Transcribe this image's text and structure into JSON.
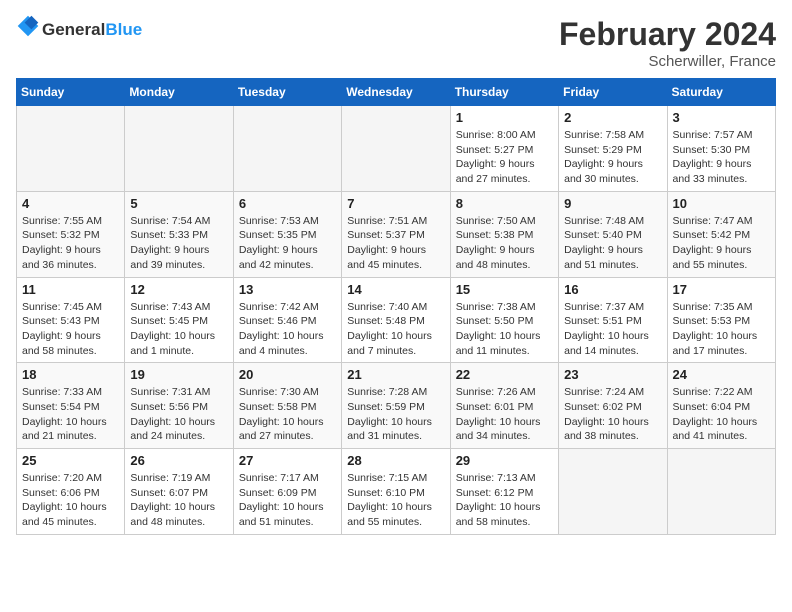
{
  "logo": {
    "line1": "General",
    "line2": "Blue"
  },
  "title": "February 2024",
  "location": "Scherwiller, France",
  "days_header": [
    "Sunday",
    "Monday",
    "Tuesday",
    "Wednesday",
    "Thursday",
    "Friday",
    "Saturday"
  ],
  "weeks": [
    [
      {
        "day": "",
        "info": ""
      },
      {
        "day": "",
        "info": ""
      },
      {
        "day": "",
        "info": ""
      },
      {
        "day": "",
        "info": ""
      },
      {
        "day": "1",
        "info": "Sunrise: 8:00 AM\nSunset: 5:27 PM\nDaylight: 9 hours\nand 27 minutes."
      },
      {
        "day": "2",
        "info": "Sunrise: 7:58 AM\nSunset: 5:29 PM\nDaylight: 9 hours\nand 30 minutes."
      },
      {
        "day": "3",
        "info": "Sunrise: 7:57 AM\nSunset: 5:30 PM\nDaylight: 9 hours\nand 33 minutes."
      }
    ],
    [
      {
        "day": "4",
        "info": "Sunrise: 7:55 AM\nSunset: 5:32 PM\nDaylight: 9 hours\nand 36 minutes."
      },
      {
        "day": "5",
        "info": "Sunrise: 7:54 AM\nSunset: 5:33 PM\nDaylight: 9 hours\nand 39 minutes."
      },
      {
        "day": "6",
        "info": "Sunrise: 7:53 AM\nSunset: 5:35 PM\nDaylight: 9 hours\nand 42 minutes."
      },
      {
        "day": "7",
        "info": "Sunrise: 7:51 AM\nSunset: 5:37 PM\nDaylight: 9 hours\nand 45 minutes."
      },
      {
        "day": "8",
        "info": "Sunrise: 7:50 AM\nSunset: 5:38 PM\nDaylight: 9 hours\nand 48 minutes."
      },
      {
        "day": "9",
        "info": "Sunrise: 7:48 AM\nSunset: 5:40 PM\nDaylight: 9 hours\nand 51 minutes."
      },
      {
        "day": "10",
        "info": "Sunrise: 7:47 AM\nSunset: 5:42 PM\nDaylight: 9 hours\nand 55 minutes."
      }
    ],
    [
      {
        "day": "11",
        "info": "Sunrise: 7:45 AM\nSunset: 5:43 PM\nDaylight: 9 hours\nand 58 minutes."
      },
      {
        "day": "12",
        "info": "Sunrise: 7:43 AM\nSunset: 5:45 PM\nDaylight: 10 hours\nand 1 minute."
      },
      {
        "day": "13",
        "info": "Sunrise: 7:42 AM\nSunset: 5:46 PM\nDaylight: 10 hours\nand 4 minutes."
      },
      {
        "day": "14",
        "info": "Sunrise: 7:40 AM\nSunset: 5:48 PM\nDaylight: 10 hours\nand 7 minutes."
      },
      {
        "day": "15",
        "info": "Sunrise: 7:38 AM\nSunset: 5:50 PM\nDaylight: 10 hours\nand 11 minutes."
      },
      {
        "day": "16",
        "info": "Sunrise: 7:37 AM\nSunset: 5:51 PM\nDaylight: 10 hours\nand 14 minutes."
      },
      {
        "day": "17",
        "info": "Sunrise: 7:35 AM\nSunset: 5:53 PM\nDaylight: 10 hours\nand 17 minutes."
      }
    ],
    [
      {
        "day": "18",
        "info": "Sunrise: 7:33 AM\nSunset: 5:54 PM\nDaylight: 10 hours\nand 21 minutes."
      },
      {
        "day": "19",
        "info": "Sunrise: 7:31 AM\nSunset: 5:56 PM\nDaylight: 10 hours\nand 24 minutes."
      },
      {
        "day": "20",
        "info": "Sunrise: 7:30 AM\nSunset: 5:58 PM\nDaylight: 10 hours\nand 27 minutes."
      },
      {
        "day": "21",
        "info": "Sunrise: 7:28 AM\nSunset: 5:59 PM\nDaylight: 10 hours\nand 31 minutes."
      },
      {
        "day": "22",
        "info": "Sunrise: 7:26 AM\nSunset: 6:01 PM\nDaylight: 10 hours\nand 34 minutes."
      },
      {
        "day": "23",
        "info": "Sunrise: 7:24 AM\nSunset: 6:02 PM\nDaylight: 10 hours\nand 38 minutes."
      },
      {
        "day": "24",
        "info": "Sunrise: 7:22 AM\nSunset: 6:04 PM\nDaylight: 10 hours\nand 41 minutes."
      }
    ],
    [
      {
        "day": "25",
        "info": "Sunrise: 7:20 AM\nSunset: 6:06 PM\nDaylight: 10 hours\nand 45 minutes."
      },
      {
        "day": "26",
        "info": "Sunrise: 7:19 AM\nSunset: 6:07 PM\nDaylight: 10 hours\nand 48 minutes."
      },
      {
        "day": "27",
        "info": "Sunrise: 7:17 AM\nSunset: 6:09 PM\nDaylight: 10 hours\nand 51 minutes."
      },
      {
        "day": "28",
        "info": "Sunrise: 7:15 AM\nSunset: 6:10 PM\nDaylight: 10 hours\nand 55 minutes."
      },
      {
        "day": "29",
        "info": "Sunrise: 7:13 AM\nSunset: 6:12 PM\nDaylight: 10 hours\nand 58 minutes."
      },
      {
        "day": "",
        "info": ""
      },
      {
        "day": "",
        "info": ""
      }
    ]
  ]
}
